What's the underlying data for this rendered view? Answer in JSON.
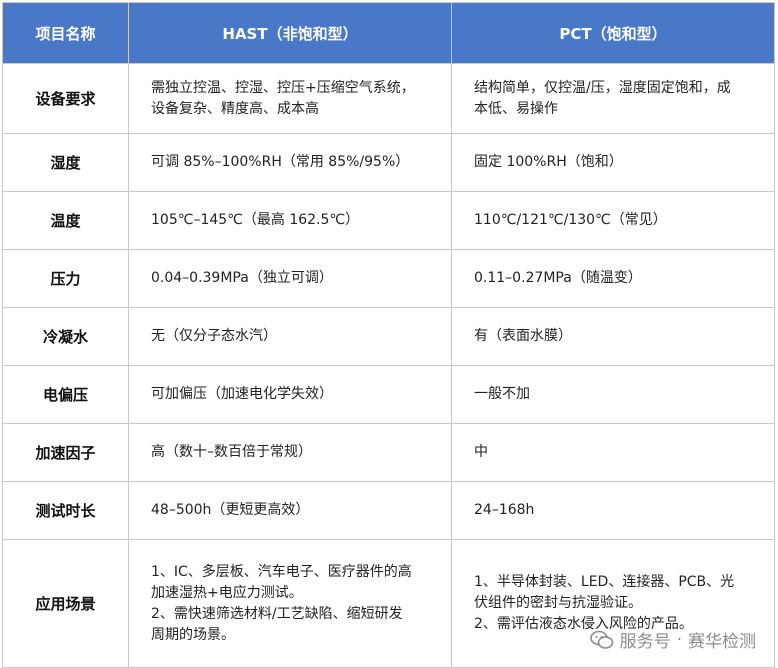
{
  "table": {
    "headers": [
      "项目名称",
      "HAST（非饱和型）",
      "PCT（饱和型）"
    ],
    "rows": [
      {
        "name": "设备要求",
        "hast": [
          "需独立控温、控湿、控压+压缩空气系统，",
          "设备复杂、精度高、成本高"
        ],
        "pct": [
          "结构简单，仅控温/压，湿度固定饱和，成",
          "本低、易操作"
        ]
      },
      {
        "name": "湿度",
        "hast": [
          "可调 85%–100%RH（常用 85%/95%）"
        ],
        "pct": [
          "固定 100%RH（饱和）"
        ]
      },
      {
        "name": "温度",
        "hast": [
          "105℃–145℃（最高 162.5℃）"
        ],
        "pct": [
          "110℃/121℃/130℃（常见）"
        ]
      },
      {
        "name": "压力",
        "hast": [
          "0.04–0.39MPa（独立可调）"
        ],
        "pct": [
          "0.11–0.27MPa（随温变）"
        ]
      },
      {
        "name": "冷凝水",
        "hast": [
          "无（仅分子态水汽）"
        ],
        "pct": [
          "有（表面水膜）"
        ]
      },
      {
        "name": "电偏压",
        "hast": [
          "可加偏压（加速电化学失效）"
        ],
        "pct": [
          "一般不加"
        ]
      },
      {
        "name": "加速因子",
        "hast": [
          "高（数十–数百倍于常规）"
        ],
        "pct": [
          "中"
        ]
      },
      {
        "name": "测试时长",
        "hast": [
          "48–500h（更短更高效）"
        ],
        "pct": [
          "24–168h"
        ]
      },
      {
        "name": "应用场景",
        "hast": [
          "1、IC、多层板、汽车电子、医疗器件的高",
          "加速湿热+电应力测试。",
          "2、需快速筛选材料/工艺缺陷、缩短研发",
          "周期的场景。"
        ],
        "pct": [
          "1、半导体封装、LED、连接器、PCB、光",
          "伏组件的密封与抗湿验证。",
          "2、需评估液态水侵入风险的产品。"
        ]
      }
    ]
  },
  "watermark": {
    "left": "服务号",
    "dot": "·",
    "right": "赛华检测",
    "icon": "wechat-icon"
  }
}
